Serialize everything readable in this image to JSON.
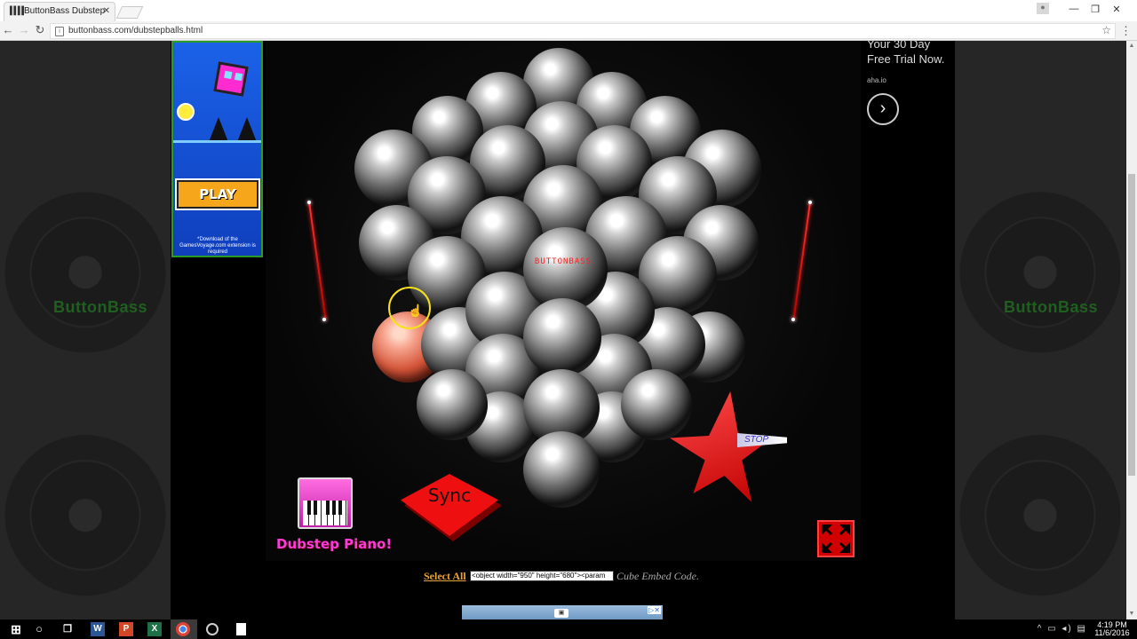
{
  "browser": {
    "tab_title": "ButtonBass Dubstep",
    "tab_close": "✕",
    "url": "buttonbass.com/dubstepballs.html",
    "window_controls": {
      "minimize": "—",
      "maximize": "❐",
      "close": "✕"
    }
  },
  "left_ad": {
    "play_label": "PLAY",
    "note": "*Download of the GamesVoyage.com extension is required"
  },
  "side_watermark": "ButtonBass",
  "stage": {
    "logo_text": "BUTTONBASS",
    "piano_label": "Dubstep Piano!",
    "sync_label": "Sync",
    "stop_label": "STOP"
  },
  "embed": {
    "select_all": "Select All",
    "code_value": "<object width=\"950\" height=\"680\"><param",
    "caption": "Cube Embed Code."
  },
  "right_ad": {
    "line1": "Your 30 Day",
    "line2": "Free Trial Now.",
    "domain": "aha.io",
    "arrow": "›"
  },
  "taskbar": {
    "time": "4:19 PM",
    "date": "11/6/2016"
  },
  "colors": {
    "accent_red": "#ee1010",
    "piano_pink": "#ff3ad8",
    "select_all_orange": "#e8a33a",
    "watermark_green": "#1f5f1f"
  }
}
